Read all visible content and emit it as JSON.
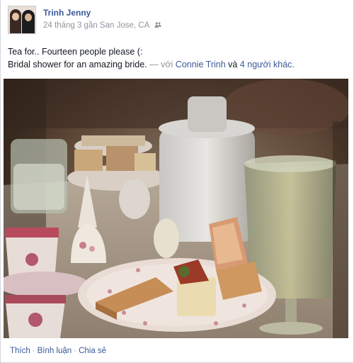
{
  "post": {
    "author": "Trinh Jenny",
    "meta": "24 tháng 3 gần San Jose, CA",
    "audience_icon": "friends-icon",
    "text_line1": "Tea for.. Fourteen people please (:",
    "text_line2": "Bridal shower for an amazing bride.",
    "with_separator": "— với",
    "tagged_person": "Connie Trinh",
    "and_word": "và",
    "others_link": "4 người khác.",
    "photo_description_icon": "photo"
  },
  "actions": {
    "like": "Thích",
    "comment": "Bình luận",
    "share": "Chia sẻ",
    "separator": "·"
  },
  "colors": {
    "link": "#3b5998",
    "meta": "#90949c",
    "text": "#141823"
  }
}
